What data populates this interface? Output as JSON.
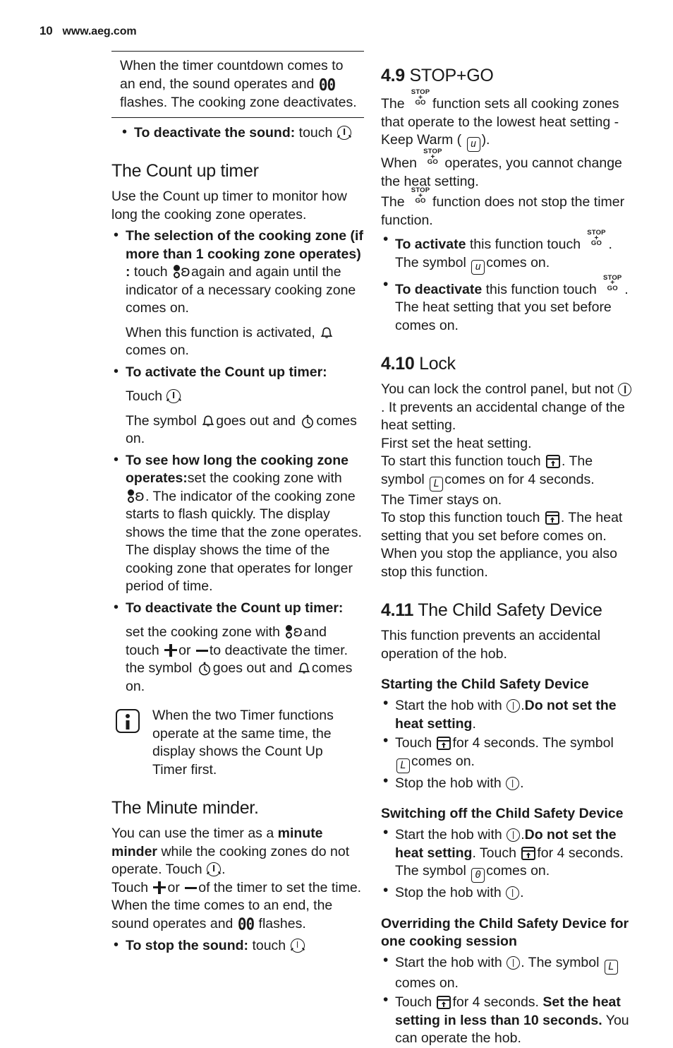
{
  "header": {
    "page_number": "10",
    "site": "www.aeg.com"
  },
  "left_column": {
    "note_box": {
      "line1": "When the timer countdown comes to",
      "line2_a": "an end, the sound operates and",
      "icon_00": "00",
      "line3": "flashes. The cooking zone deactivates."
    },
    "note_after": {
      "bold": "To deactivate the sound:",
      "rest": "touch"
    },
    "count_up": {
      "heading": "The Count up timer",
      "intro": "Use the Count up timer to monitor how long the cooking zone operates.",
      "b1_bold": "The selection of the cooking zone (if more than 1 cooking zone operates) :",
      "b1_t1": "touch",
      "b1_t2": "again and again until the indicator of a necessary cooking zone comes on.",
      "b1_sub_a": "When this function is activated,",
      "b1_sub_b": "comes on.",
      "b2_bold": "To activate the Count up timer:",
      "b2_t1": "Touch",
      "b2_t2": "The symbol",
      "b2_t3": "goes out and",
      "b2_t4": "comes on.",
      "b3_bold": "To see how long the cooking zone operates:",
      "b3_t1": "set the cooking zone with",
      "b3_t2": ". The indicator of the cooking zone starts to flash quickly. The display shows the time that the zone operates. The display shows the time of the cooking zone that operates for longer period of time.",
      "b4_bold": "To deactivate the Count up timer:",
      "b4_t1": "set the cooking zone with",
      "b4_t2": "and touch",
      "b4_t3": "or",
      "b4_t4": "to deactivate the timer. the symbol",
      "b4_t5": "goes out and",
      "b4_t6": "comes on.",
      "callout": "When the two Timer functions operate at the same time, the display shows the Count Up Timer first."
    },
    "minute_minder": {
      "heading": "The Minute minder.",
      "p1_a": "You can use the timer as a",
      "p1_bold": "minute minder",
      "p1_b": "while the cooking zones do not operate. Touch",
      "p1_c": ".",
      "p2_a": "Touch",
      "p2_b": "or",
      "p2_c": "of the timer to set the time. When the time comes to an end, the sound operates and",
      "p2_d": "flashes.",
      "b1_bold": "To stop the sound:",
      "b1_rest": "touch"
    }
  },
  "right_column": {
    "stop_go": {
      "num": "4.9",
      "title": "STOP+GO",
      "p1_a": "The",
      "p1_b": "function sets all cooking zones that operate to the lowest heat setting - Keep Warm (",
      "p1_c": ").",
      "p2_a": "When",
      "p2_b": "operates, you cannot change the heat setting.",
      "p3_a": "The",
      "p3_b": "function does not stop the timer function.",
      "b1_bold": "To activate",
      "b1_a": "this function touch",
      "b1_b": ".",
      "b1_c": "The symbol",
      "b1_d": "comes on.",
      "b2_bold": "To deactivate",
      "b2_a": "this function touch",
      "b2_b": ".",
      "b2_c": "The heat setting that you set before comes on."
    },
    "lock": {
      "num": "4.10",
      "title": "Lock",
      "p1_a": "You can lock the control panel, but not",
      "p1_b": ". It prevents an accidental change of the heat setting.",
      "p2": "First set the heat setting.",
      "p3_a": "To start this function touch",
      "p3_b": ". The symbol",
      "p3_c": "comes on for 4 seconds.",
      "p4": "The Timer stays on.",
      "p5_a": "To stop this function touch",
      "p5_b": ". The heat setting that you set before comes on. When you stop the appliance, you also stop this function."
    },
    "child_safety": {
      "num": "4.11",
      "title": "The Child Safety Device",
      "intro": "This function prevents an accidental operation of the hob.",
      "sub1": "Starting the Child Safety Device",
      "s1_b1_a": "Start the hob with",
      "s1_b1_bold": "Do not set the heat setting",
      "s1_b1_b": ".",
      "s1_b2_a": "Touch",
      "s1_b2_b": "for 4 seconds. The symbol",
      "s1_b2_c": "comes on.",
      "s1_b3_a": "Stop the hob with",
      "s1_b3_b": ".",
      "sub2": "Switching off the Child Safety Device",
      "s2_b1_a": "Start the hob with",
      "s2_b1_bold": "Do not set the heat setting",
      "s2_b1_b": ". Touch",
      "s2_b1_c": "for 4 seconds. The symbol",
      "s2_b1_d": "comes on.",
      "s2_b2_a": "Stop the hob with",
      "s2_b2_b": ".",
      "sub3": "Overriding the Child Safety Device for one cooking session",
      "s3_b1_a": "Start the hob with",
      "s3_b1_b": ". The symbol",
      "s3_b1_c": "comes on.",
      "s3_b2_a": "Touch",
      "s3_b2_b": "for 4 seconds.",
      "s3_b2_bold": "Set the heat setting in less than 10 seconds.",
      "s3_b2_c": "You can operate the hob."
    }
  },
  "icons": {
    "stopgo_line1": "STOP",
    "stopgo_line2": "+",
    "stopgo_line3": "GO",
    "display_u": "u",
    "display_L": "L",
    "display_0": "0",
    "display_00": "00",
    "zone_curl": "ʚ"
  }
}
